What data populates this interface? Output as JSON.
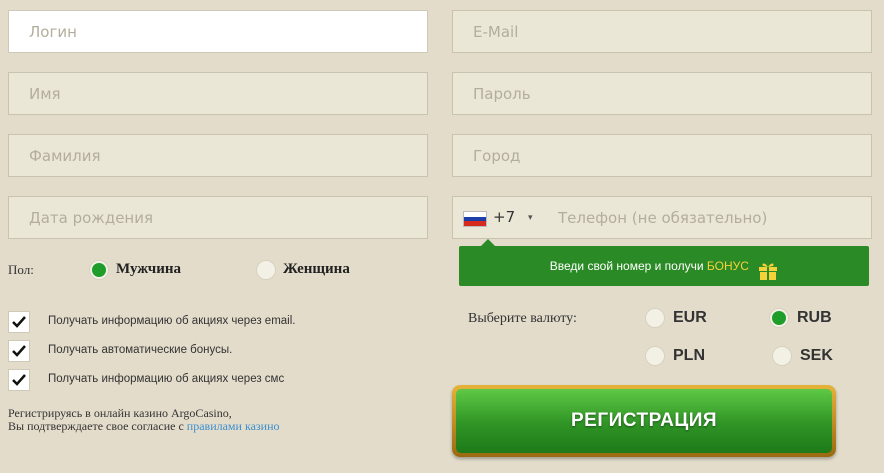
{
  "fields": {
    "login": "Логин",
    "email": "E-Mail",
    "first_name": "Имя",
    "password": "Пароль",
    "last_name": "Фамилия",
    "city": "Город",
    "birth_date": "Дата рождения"
  },
  "phone": {
    "code": "+7",
    "caret": "▾",
    "placeholder": "Телефон (не обязательно)",
    "bonus_prefix": "Введи свой номер и получи ",
    "bonus_word": "БОНУС"
  },
  "gender": {
    "label": "Пол:",
    "options": [
      {
        "label": "Мужчина",
        "selected": true
      },
      {
        "label": "Женщина",
        "selected": false
      }
    ]
  },
  "checkboxes": [
    {
      "label": "Получать информацию об акциях через email.",
      "checked": true
    },
    {
      "label": "Получать автоматические бонусы.",
      "checked": true
    },
    {
      "label": "Получать информацию об акциях через смс",
      "checked": true
    }
  ],
  "agreement": {
    "line1": "Регистрируясь в онлайн казино ArgoCasino,",
    "line2": "Вы подтверждаете свое согласие с ",
    "link": "правилами казино"
  },
  "currency": {
    "label": "Выберите валюту:",
    "options": [
      {
        "code": "EUR",
        "selected": false
      },
      {
        "code": "RUB",
        "selected": true
      },
      {
        "code": "PLN",
        "selected": false
      },
      {
        "code": "SEK",
        "selected": false
      }
    ]
  },
  "register_button": "РЕГИСТРАЦИЯ",
  "colors": {
    "background": "#e3dccb",
    "accent_green": "#2a8a25",
    "bonus_yellow": "#f5d23a",
    "link_blue": "#3c8fce"
  }
}
